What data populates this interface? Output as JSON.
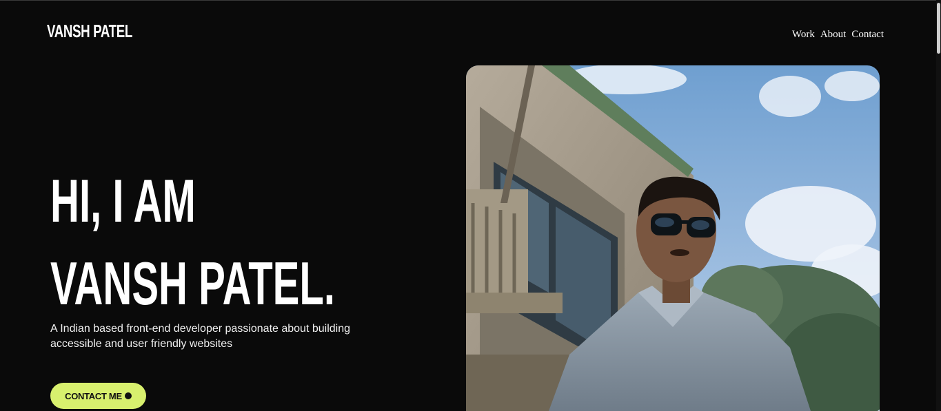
{
  "header": {
    "logo": "VANSH PATEL",
    "nav": [
      {
        "label": "Work"
      },
      {
        "label": "About"
      },
      {
        "label": "Contact"
      }
    ]
  },
  "hero": {
    "title_line1": "HI, I AM",
    "title_line2": "VANSH PATEL.",
    "subtitle_line1": "A Indian based front-end developer passionate about building",
    "subtitle_line2": "accessible and user friendly websites",
    "cta_label": "CONTACT ME"
  },
  "colors": {
    "background": "#0a0a0a",
    "accent": "#d8f06e",
    "text": "#ffffff"
  },
  "icons": {
    "cta": "dot-icon"
  }
}
